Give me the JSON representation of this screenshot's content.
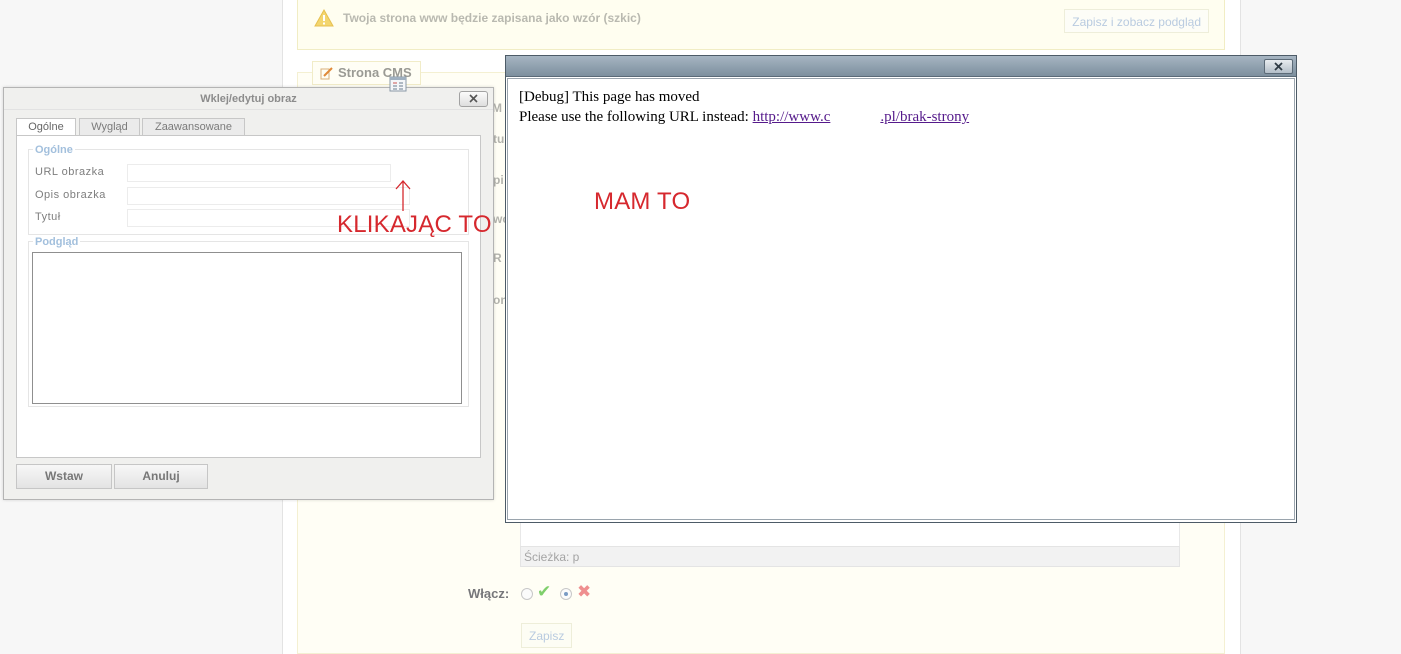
{
  "background_page": {
    "warning_text": "Twoja strona www będzie zapisana jako wzór (szkic)",
    "preview_button": "Zapisz i zobacz podgląd",
    "cms_tab_label": "Strona CMS",
    "fragments": [
      "M",
      "tu",
      "pi",
      "wo",
      "R",
      "on"
    ],
    "path_label": "Ścieżka: p",
    "enable_label": "Włącz:",
    "save_button": "Zapisz"
  },
  "image_dialog": {
    "title": "Wklej/edytuj obraz",
    "tabs": [
      {
        "label": "Ogólne",
        "active": true
      },
      {
        "label": "Wygląd",
        "active": false
      },
      {
        "label": "Zaawansowane",
        "active": false
      }
    ],
    "general_legend": "Ogólne",
    "fields": [
      {
        "label": "URL obrazka",
        "value": ""
      },
      {
        "label": "Opis obrazka",
        "value": ""
      },
      {
        "label": "Tytuł",
        "value": ""
      }
    ],
    "preview_legend": "Podgląd",
    "insert_button": "Wstaw",
    "cancel_button": "Anuluj"
  },
  "debug_popup": {
    "line1": "[Debug] This page has moved",
    "line2_prefix": "Please use the following URL instead: ",
    "url_start": "http://www.c",
    "url_end": ".pl/brak-strony"
  },
  "annotations": {
    "click_label": "KLIKAJĄC TO",
    "result_label": "MAM TO"
  },
  "colors": {
    "annotation_red": "#d6282e",
    "popup_titlebar": "#8d9eac",
    "link": "#551a8b",
    "legend_blue": "#a3c0dd"
  }
}
